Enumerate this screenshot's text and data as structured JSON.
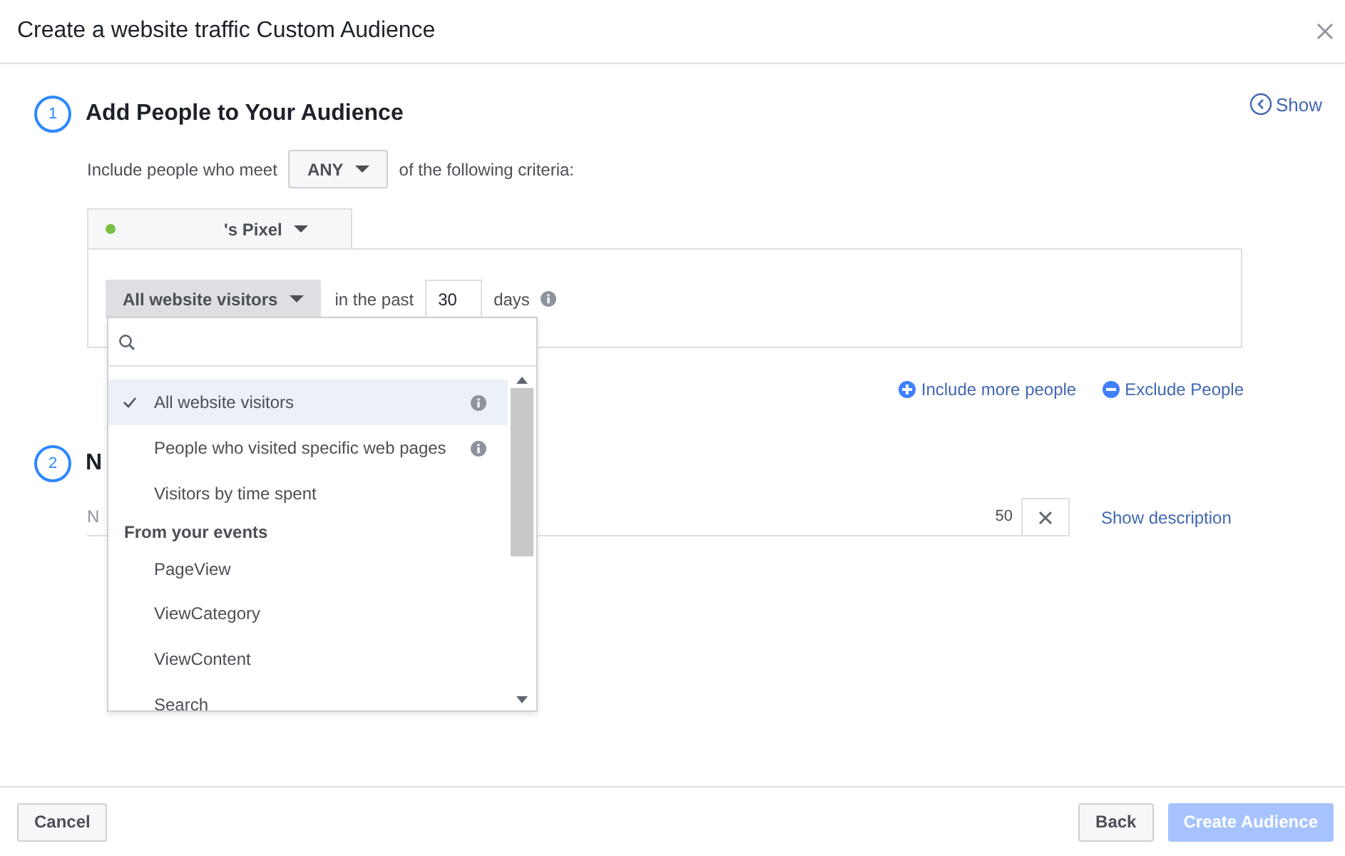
{
  "dialog": {
    "title": "Create a website traffic Custom Audience"
  },
  "show_link": "Show",
  "step1": {
    "number": "1",
    "title": "Add People to Your Audience"
  },
  "criteria": {
    "prefix": "Include people who meet",
    "match": "ANY",
    "suffix": "of the following criteria:"
  },
  "pixel": {
    "name": "'s Pixel"
  },
  "rule": {
    "event": "All website visitors",
    "prefix": "in the past",
    "days": "30",
    "unit": "days"
  },
  "menu": {
    "items": [
      {
        "kind": "option",
        "label": "All website visitors",
        "selected": true,
        "info": true
      },
      {
        "kind": "option",
        "label": "People who visited specific web pages",
        "selected": false,
        "info": true
      },
      {
        "kind": "option",
        "label": "Visitors by time spent",
        "selected": false,
        "info": false
      },
      {
        "kind": "heading",
        "label": "From your events"
      },
      {
        "kind": "option",
        "label": "PageView",
        "selected": false,
        "info": false
      },
      {
        "kind": "option",
        "label": "ViewCategory",
        "selected": false,
        "info": false
      },
      {
        "kind": "option",
        "label": "ViewContent",
        "selected": false,
        "info": false
      },
      {
        "kind": "option",
        "label": "Search",
        "selected": false,
        "info": false
      }
    ]
  },
  "links": [
    {
      "kind": "include",
      "label": "Include more people"
    },
    {
      "kind": "exclude",
      "label": "Exclude People"
    }
  ],
  "step2": {
    "number": "2",
    "title": "N"
  },
  "name_field": {
    "placeholder": "N",
    "counter": "50"
  },
  "show_description": "Show description",
  "footer": {
    "cancel": "Cancel",
    "back": "Back",
    "create": {
      "label": "Create Audience",
      "disabled": true
    }
  }
}
